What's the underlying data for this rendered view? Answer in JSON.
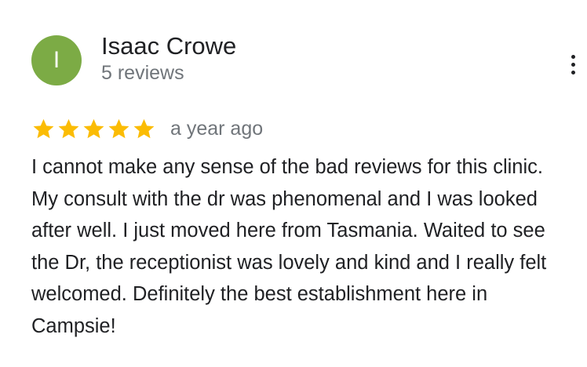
{
  "reviewer": {
    "initial": "I",
    "name": "Isaac Crowe",
    "reviews_count": "5 reviews"
  },
  "rating": {
    "value": 5,
    "max": 5,
    "star_color": "#fbbc04"
  },
  "avatar_color": "#7cab45",
  "time_ago": "a year ago",
  "review_text": "I cannot make any sense of the bad reviews for this clinic. My consult with the dr was phenomenal and I was looked after well. I just moved here from Tasmania. Waited to see the Dr, the receptionist was lovely and kind and I really felt welcomed. Definitely the best establishment here in Campsie!",
  "icons": {
    "more": "more-vert-icon",
    "star": "star-icon"
  }
}
